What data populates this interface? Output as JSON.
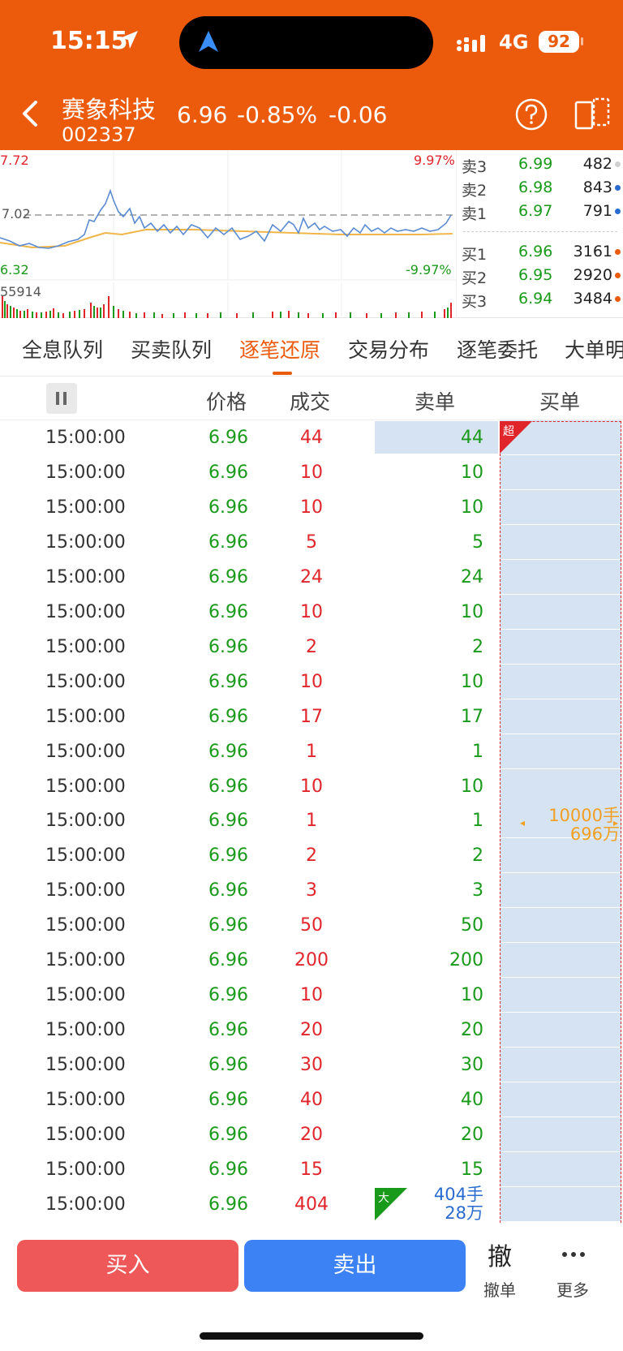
{
  "status_bar": {
    "time": "15:15",
    "network": "4G",
    "battery": "92"
  },
  "stock": {
    "name": "赛象科技",
    "code": "002337",
    "price": "6.96",
    "change_pct": "-0.85%",
    "change": "-0.06"
  },
  "chart": {
    "y_max": "7.72",
    "y_mid": "7.02",
    "y_min": "6.32",
    "pct_max": "9.97%",
    "pct_min": "-9.97%",
    "volume_label": "55914"
  },
  "orderbook": [
    {
      "label": "卖3",
      "price": "6.99",
      "volume": "482",
      "dot": "#d0d0d0"
    },
    {
      "label": "卖2",
      "price": "6.98",
      "volume": "843",
      "dot": "#2a6bd0"
    },
    {
      "label": "卖1",
      "price": "6.97",
      "volume": "791",
      "dot": "#2a6bd0"
    },
    {
      "label": "买1",
      "price": "6.96",
      "volume": "3161",
      "dot": "#ec5a0c"
    },
    {
      "label": "买2",
      "price": "6.95",
      "volume": "2920",
      "dot": "#ec5a0c"
    },
    {
      "label": "买3",
      "price": "6.94",
      "volume": "3484",
      "dot": "#ec5a0c"
    }
  ],
  "tabs": [
    "全息队列",
    "买卖队列",
    "逐笔还原",
    "交易分布",
    "逐笔委托",
    "大单明"
  ],
  "active_tab": "逐笔还原",
  "table": {
    "headers": {
      "price": "价格",
      "volume": "成交",
      "sell": "卖单",
      "buy": "买单"
    },
    "rows": [
      {
        "time": "15:00:00",
        "price": "6.96",
        "volume": "44",
        "sell": "44"
      },
      {
        "time": "15:00:00",
        "price": "6.96",
        "volume": "10",
        "sell": "10"
      },
      {
        "time": "15:00:00",
        "price": "6.96",
        "volume": "10",
        "sell": "10"
      },
      {
        "time": "15:00:00",
        "price": "6.96",
        "volume": "5",
        "sell": "5"
      },
      {
        "time": "15:00:00",
        "price": "6.96",
        "volume": "24",
        "sell": "24"
      },
      {
        "time": "15:00:00",
        "price": "6.96",
        "volume": "10",
        "sell": "10"
      },
      {
        "time": "15:00:00",
        "price": "6.96",
        "volume": "2",
        "sell": "2"
      },
      {
        "time": "15:00:00",
        "price": "6.96",
        "volume": "10",
        "sell": "10"
      },
      {
        "time": "15:00:00",
        "price": "6.96",
        "volume": "17",
        "sell": "17"
      },
      {
        "time": "15:00:00",
        "price": "6.96",
        "volume": "1",
        "sell": "1"
      },
      {
        "time": "15:00:00",
        "price": "6.96",
        "volume": "10",
        "sell": "10"
      },
      {
        "time": "15:00:00",
        "price": "6.96",
        "volume": "1",
        "sell": "1"
      },
      {
        "time": "15:00:00",
        "price": "6.96",
        "volume": "2",
        "sell": "2"
      },
      {
        "time": "15:00:00",
        "price": "6.96",
        "volume": "3",
        "sell": "3"
      },
      {
        "time": "15:00:00",
        "price": "6.96",
        "volume": "50",
        "sell": "50"
      },
      {
        "time": "15:00:00",
        "price": "6.96",
        "volume": "200",
        "sell": "200"
      },
      {
        "time": "15:00:00",
        "price": "6.96",
        "volume": "10",
        "sell": "10"
      },
      {
        "time": "15:00:00",
        "price": "6.96",
        "volume": "20",
        "sell": "20"
      },
      {
        "time": "15:00:00",
        "price": "6.96",
        "volume": "30",
        "sell": "30"
      },
      {
        "time": "15:00:00",
        "price": "6.96",
        "volume": "40",
        "sell": "40"
      },
      {
        "time": "15:00:00",
        "price": "6.96",
        "volume": "20",
        "sell": "20"
      },
      {
        "time": "15:00:00",
        "price": "6.96",
        "volume": "15",
        "sell": "15"
      },
      {
        "time": "15:00:00",
        "price": "6.96",
        "volume": "404",
        "sell": ""
      }
    ],
    "super_badge": "超",
    "big_buy_block": {
      "lots": "10000手",
      "amount": "696万"
    },
    "last_row_badge": "大",
    "last_row_sell_info": {
      "lots": "404手",
      "amount": "28万"
    }
  },
  "bottom": {
    "buy": "买入",
    "sell": "卖出",
    "cancel_glyph": "撤",
    "cancel_label": "撤单",
    "more_label": "更多"
  },
  "colors": {
    "brand": "#ec5a0c",
    "up": "#e0252b",
    "down": "#1a9a1a",
    "buy_button": "#ef5858",
    "sell_button": "#3d82f5",
    "highlight": "#d6e3f3"
  }
}
